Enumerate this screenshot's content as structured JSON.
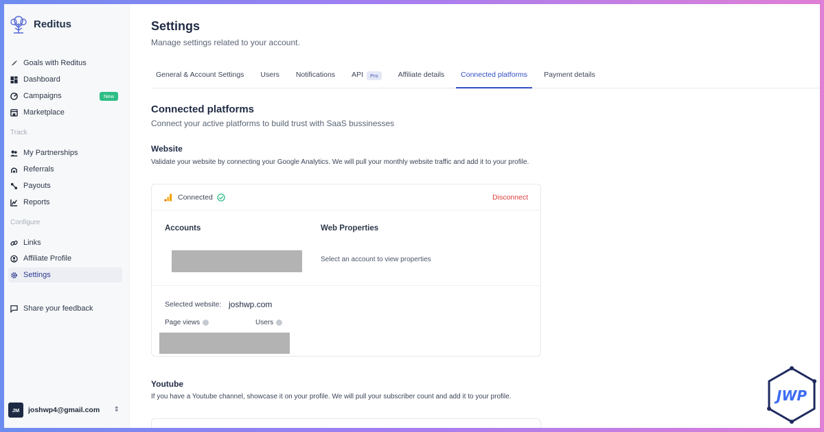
{
  "brand": {
    "name": "Reditus"
  },
  "sidebar": {
    "items_top": [
      {
        "label": "Goals with Reditus",
        "icon": "rocket-icon"
      },
      {
        "label": "Dashboard",
        "icon": "dashboard-icon"
      },
      {
        "label": "Campaigns",
        "icon": "campaigns-icon",
        "badge": "New"
      },
      {
        "label": "Marketplace",
        "icon": "store-icon"
      }
    ],
    "track_label": "Track",
    "items_track": [
      {
        "label": "My Partnerships",
        "icon": "users-icon"
      },
      {
        "label": "Referrals",
        "icon": "referrals-icon"
      },
      {
        "label": "Payouts",
        "icon": "payouts-icon"
      },
      {
        "label": "Reports",
        "icon": "reports-icon"
      }
    ],
    "configure_label": "Configure",
    "items_configure": [
      {
        "label": "Links",
        "icon": "link-icon"
      },
      {
        "label": "Affiliate Profile",
        "icon": "profile-icon"
      },
      {
        "label": "Settings",
        "icon": "gear-icon",
        "active": true
      }
    ],
    "feedback_label": "Share your feedback",
    "user": {
      "initials": "JM",
      "email": "joshwp4@gmail.com"
    }
  },
  "header": {
    "title": "Settings",
    "subtitle": "Manage settings related to your account."
  },
  "tabs": [
    {
      "label": "General & Account Settings"
    },
    {
      "label": "Users"
    },
    {
      "label": "Notifications"
    },
    {
      "label": "API",
      "badge": "Pro"
    },
    {
      "label": "Affiliate details"
    },
    {
      "label": "Connected platforms",
      "active": true
    },
    {
      "label": "Payment details"
    }
  ],
  "section": {
    "title": "Connected platforms",
    "subtitle": "Connect your active platforms to build trust with SaaS bussinesses"
  },
  "website": {
    "title": "Website",
    "description": "Validate your website by connecting your Google Analytics. We will pull your monthly website traffic and add it to your profile.",
    "status": "Connected",
    "disconnect_label": "Disconnect",
    "accounts_label": "Accounts",
    "web_properties_label": "Web Properties",
    "properties_hint": "Select an account to view properties",
    "selected_label": "Selected website:",
    "selected_value": "joshwp.com",
    "page_views_label": "Page views",
    "users_label": "Users"
  },
  "youtube": {
    "title": "Youtube",
    "description": "If you have a Youtube channel, showcase it on your profile. We will pull your subscriber count and add it to your profile."
  },
  "watermark": {
    "text": "JWP"
  },
  "colors": {
    "accent": "#2f4ec1",
    "danger": "#e03a3a",
    "success": "#2ebd85",
    "sidebar_bg": "#f7f8fa",
    "redaction": "#b3b3b3"
  }
}
